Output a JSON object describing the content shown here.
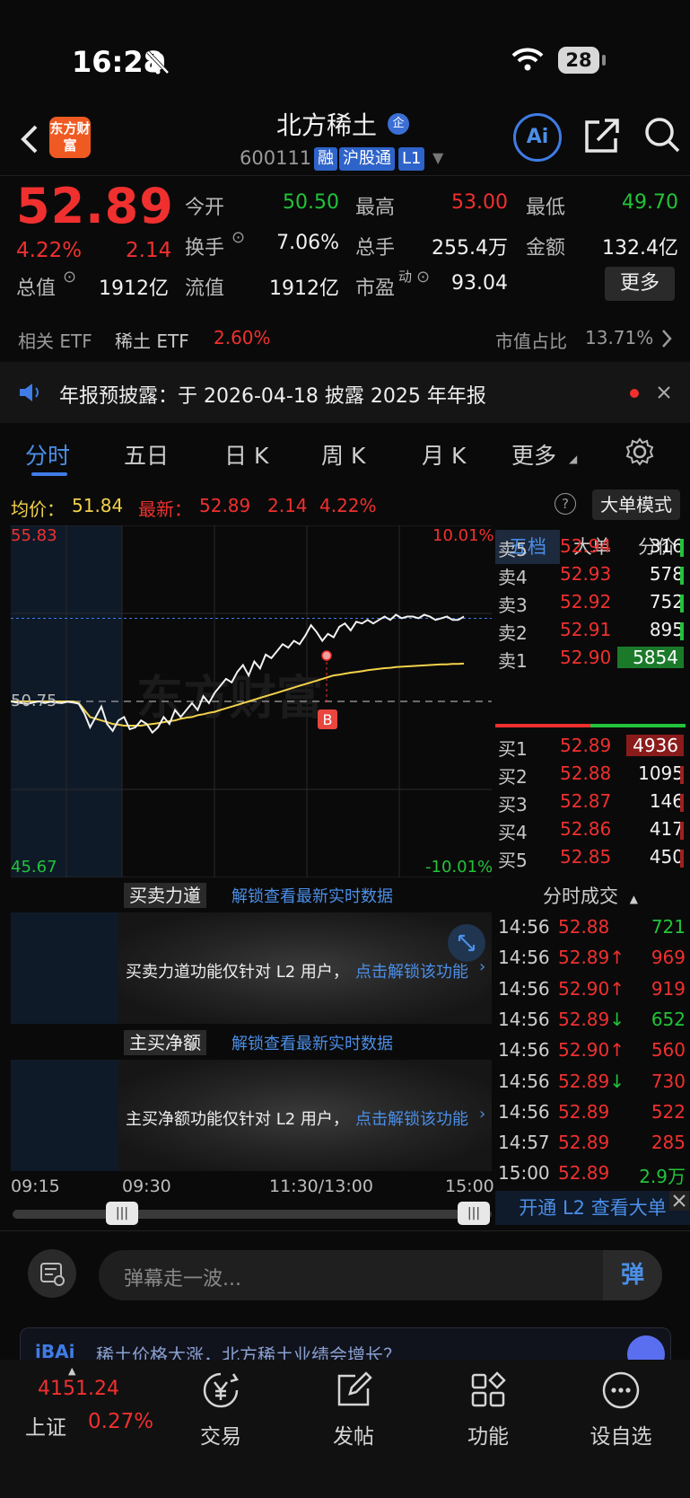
{
  "status": {
    "time": "16:28",
    "battery": "28"
  },
  "header": {
    "logo_text": "东方财富",
    "stock_name": "北方稀土",
    "badge": "企",
    "code": "600111",
    "tags": [
      "融",
      "沪股通",
      "L1"
    ],
    "ai_label": "Ai"
  },
  "quote": {
    "price": "52.89",
    "pct": "4.22%",
    "change": "2.14",
    "fields": [
      {
        "label": "今开",
        "value": "50.50",
        "color": "#22c33a"
      },
      {
        "label": "最高",
        "value": "53.00",
        "color": "#f0302f"
      },
      {
        "label": "最低",
        "value": "49.70",
        "color": "#22c33a"
      },
      {
        "label": "换手",
        "value": "7.06%",
        "color": "#f2f2f2"
      },
      {
        "label": "总手",
        "value": "255.4万",
        "color": "#f2f2f2"
      },
      {
        "label": "金额",
        "value": "132.4亿",
        "color": "#f2f2f2"
      },
      {
        "label": "总值",
        "value": "1912亿",
        "color": "#f2f2f2"
      },
      {
        "label": "流值",
        "value": "1912亿",
        "color": "#f2f2f2"
      },
      {
        "label": "市盈",
        "value": "93.04",
        "color": "#f2f2f2"
      }
    ],
    "pe_sup": "动",
    "more_label": "更多"
  },
  "etf": {
    "label1": "相关 ETF",
    "label2": "稀土 ETF",
    "value": "2.60%",
    "ratio_label": "市值占比",
    "ratio": "13.71%"
  },
  "notice": {
    "text": "年报预披露：于 2026-04-18 披露 2025 年年报"
  },
  "tabs": [
    "分时",
    "五日",
    "日 K",
    "周 K",
    "月 K",
    "更多"
  ],
  "avg_row": {
    "avg_label": "均价：",
    "avg_value": "51.84",
    "latest_label": "最新：",
    "latest_value": "52.89",
    "latest_chg": "2.14",
    "latest_pct": "4.22%",
    "bigorder_label": "大单模式"
  },
  "chart_data": {
    "type": "line",
    "y_top": "55.83",
    "y_mid": "50.75",
    "y_bottom": "45.67",
    "pct_top": "10.01%",
    "pct_bottom": "-10.01%",
    "ylim": [
      45.67,
      55.83
    ],
    "pre_close": 50.75,
    "watermark": "东方财富",
    "marker": "B",
    "series": [
      {
        "values": [
          50.75,
          50.72,
          50.7,
          50.68,
          50.72,
          50.75,
          50.7,
          50.74,
          50.72,
          50.7,
          50.74,
          50.72,
          50.68,
          50.4,
          50.0,
          50.3,
          50.6,
          50.1,
          49.9,
          50.2,
          50.3,
          49.95,
          50.0,
          50.2,
          50.1,
          49.85,
          50.0,
          50.3,
          50.1,
          50.5,
          50.3,
          50.5,
          50.7,
          50.5,
          50.9,
          50.7,
          51.0,
          51.2,
          51.4,
          51.3,
          51.6,
          51.8,
          51.5,
          51.9,
          51.7,
          52.1,
          52.0,
          52.2,
          52.4,
          52.3,
          52.5,
          52.4,
          52.65,
          52.95,
          52.75,
          52.5,
          52.7,
          52.6,
          52.9,
          53.0,
          52.8,
          53.05,
          53.0,
          53.1,
          53.0,
          53.1,
          53.2,
          53.1,
          53.25,
          53.15,
          53.2,
          53.2,
          53.15,
          53.25,
          53.2,
          53.1,
          53.15,
          53.2,
          53.1,
          53.1,
          53.2
        ]
      },
      {
        "values": [
          50.75,
          50.75,
          50.75,
          50.75,
          50.75,
          50.75,
          50.75,
          50.75,
          50.75,
          50.75,
          50.75,
          50.75,
          50.7,
          50.5,
          50.3,
          50.25,
          50.2,
          50.15,
          50.1,
          50.08,
          50.05,
          50.05,
          50.05,
          50.05,
          50.08,
          50.1,
          50.12,
          50.15,
          50.18,
          50.2,
          50.25,
          50.28,
          50.3,
          50.35,
          50.38,
          50.42,
          50.45,
          50.5,
          50.55,
          50.6,
          50.65,
          50.7,
          50.75,
          50.8,
          50.85,
          50.9,
          50.95,
          51.0,
          51.05,
          51.1,
          51.15,
          51.2,
          51.25,
          51.3,
          51.35,
          51.4,
          51.45,
          51.5,
          51.52,
          51.55,
          51.58,
          51.6,
          51.62,
          51.65,
          51.67,
          51.69,
          51.71,
          51.72,
          51.74,
          51.75,
          51.76,
          51.77,
          51.78,
          51.79,
          51.8,
          51.81,
          51.82,
          51.82,
          51.83,
          51.83,
          51.84
        ]
      }
    ]
  },
  "orderbook": {
    "tabs": [
      "五档",
      "大单",
      "分价"
    ],
    "asks": [
      {
        "label": "卖5",
        "price": "52.94",
        "vol": "316"
      },
      {
        "label": "卖4",
        "price": "52.93",
        "vol": "578"
      },
      {
        "label": "卖3",
        "price": "52.92",
        "vol": "752"
      },
      {
        "label": "卖2",
        "price": "52.91",
        "vol": "895"
      },
      {
        "label": "卖1",
        "price": "52.90",
        "vol": "5854"
      }
    ],
    "bids": [
      {
        "label": "买1",
        "price": "52.89",
        "vol": "4936"
      },
      {
        "label": "买2",
        "price": "52.88",
        "vol": "1095"
      },
      {
        "label": "买3",
        "price": "52.87",
        "vol": "146"
      },
      {
        "label": "买4",
        "price": "52.86",
        "vol": "417"
      },
      {
        "label": "买5",
        "price": "52.85",
        "vol": "450"
      }
    ]
  },
  "trades": {
    "title": "分时成交",
    "rows": [
      {
        "time": "14:56",
        "price": "52.88",
        "vol": "721",
        "color": "#22c33a"
      },
      {
        "time": "14:56",
        "price": "52.89↑",
        "vol": "969",
        "color": "#f0302f"
      },
      {
        "time": "14:56",
        "price": "52.90↑",
        "vol": "919",
        "color": "#f0302f"
      },
      {
        "time": "14:56",
        "price": "52.89↓",
        "vol": "652",
        "color": "#22c33a"
      },
      {
        "time": "14:56",
        "price": "52.90↑",
        "vol": "560",
        "color": "#f0302f"
      },
      {
        "time": "14:56",
        "price": "52.89↓",
        "vol": "730",
        "color": "#f0302f"
      },
      {
        "time": "14:56",
        "price": "52.89",
        "vol": "522",
        "color": "#f0302f"
      },
      {
        "time": "14:57",
        "price": "52.89",
        "vol": "285",
        "color": "#f0302f"
      },
      {
        "time": "15:00",
        "price": "52.89",
        "vol": "2.9万",
        "color": "#22c33a"
      }
    ]
  },
  "sub1": {
    "title": "买卖力道",
    "unlock": "解锁查看最新实时数据",
    "msg": "买卖力道功能仅针对 L2 用户，",
    "link": "点击解锁该功能"
  },
  "sub2": {
    "title": "主买净额",
    "unlock": "解锁查看最新实时数据",
    "msg": "主买净额功能仅针对 L2 用户，",
    "link": "点击解锁该功能"
  },
  "timeaxis": [
    "09:15",
    "09:30",
    "11:30/13:00",
    "15:00"
  ],
  "open_l2": "开通 L2 查看大单",
  "danmu": {
    "placeholder": "弹幕走一波...",
    "button": "弹"
  },
  "ai_strip": {
    "text": "稀土价格大涨，北方稀土业绩会增长？"
  },
  "bottom_nav": {
    "index_value": "4151.24",
    "index_name": "上证",
    "index_pct": "0.27%",
    "items": [
      "交易",
      "发帖",
      "功能",
      "设自选"
    ]
  }
}
